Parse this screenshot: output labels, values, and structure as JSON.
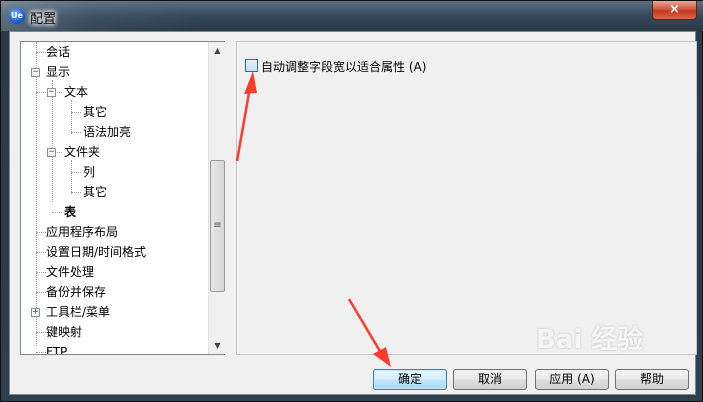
{
  "window": {
    "title": "配置",
    "app_icon": "app-logo-icon",
    "close_glyph": "×"
  },
  "tree": {
    "items": [
      {
        "label": "会话"
      },
      {
        "label": "显示",
        "expander": "−"
      },
      {
        "label": "文本",
        "expander": "−"
      },
      {
        "label": "其它"
      },
      {
        "label": "语法加亮"
      },
      {
        "label": "文件夹",
        "expander": "−"
      },
      {
        "label": "列"
      },
      {
        "label": "其它"
      },
      {
        "label": "表",
        "selected": true
      },
      {
        "label": "应用程序布局"
      },
      {
        "label": "设置日期/时间格式"
      },
      {
        "label": "文件处理"
      },
      {
        "label": "备份并保存"
      },
      {
        "label": "工具栏/菜单",
        "expander": "+"
      },
      {
        "label": "键映射"
      },
      {
        "label": "FTP"
      }
    ]
  },
  "scrollbar": {
    "up_glyph": "▲",
    "down_glyph": "▼",
    "grip_glyph": "≡"
  },
  "options": {
    "auto_adjust_label": "自动调整字段宽以适合属性 (A)",
    "auto_adjust_checked": false
  },
  "buttons": {
    "ok": "确定",
    "cancel": "取消",
    "apply": "应用 (A)",
    "help": "帮助"
  },
  "watermark": "Bai 经验",
  "colors": {
    "annotation_arrow": "#ff3b30"
  }
}
